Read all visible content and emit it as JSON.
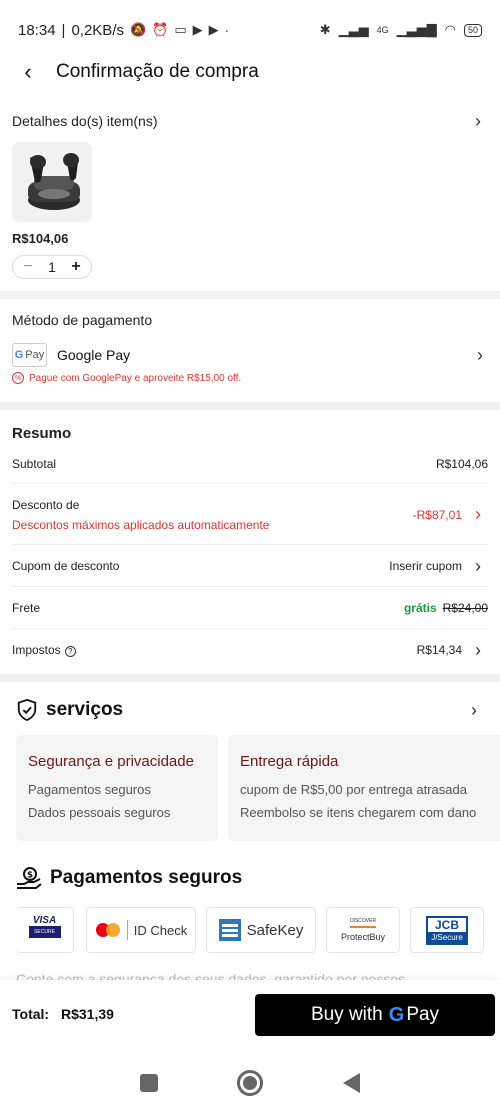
{
  "status_bar": {
    "time": "18:34",
    "speed": "0,2KB/s",
    "dot": "·",
    "network_4g": "4G",
    "battery": "50"
  },
  "header": {
    "title": "Confirmação de compra"
  },
  "items": {
    "section_title": "Detalhes do(s) item(ns)",
    "price": "R$104,06",
    "quantity": "1",
    "minus": "−",
    "plus": "+"
  },
  "payment": {
    "section_title": "Método de pagamento",
    "method_name": "Google Pay",
    "badge_pay": "Pay",
    "promo_text": "Pague com GooglePay e aproveite R$15,00 off."
  },
  "summary": {
    "title": "Resumo",
    "subtotal_label": "Subtotal",
    "subtotal_value": "R$104,06",
    "discount_label": "Desconto de",
    "discount_note": "Descontos máximos aplicados automaticamente",
    "discount_value": "-R$87,01",
    "coupon_label": "Cupom de desconto",
    "coupon_action": "Inserir cupom",
    "shipping_label": "Frete",
    "shipping_free": "grátis",
    "shipping_original": "R$24,00",
    "taxes_label": "Impostos",
    "taxes_value": "R$14,34"
  },
  "services": {
    "title": "serviços",
    "cards": [
      {
        "title": "Segurança e privacidade",
        "lines": [
          "Pagamentos seguros",
          "Dados pessoais seguros"
        ]
      },
      {
        "title": "Entrega rápida",
        "lines": [
          "cupom de R$5,00 por entrega atrasada",
          "Reembolso se itens chegarem com dano"
        ]
      }
    ]
  },
  "secure_payments": {
    "title": "Pagamentos seguros",
    "brands": {
      "visa": "VISA",
      "visa_sub": "SECURE",
      "mc": "ID Check",
      "amex": "SafeKey",
      "discover_top": "DISCOVER",
      "discover_bottom": "ProtectBuy",
      "jcb": "JCB",
      "jcb_sub": "J/Secure"
    },
    "partial_text": "Conte com a segurança dos seus dados, garantido por nossos"
  },
  "footer": {
    "total_label": "Total:",
    "total_value": "R$31,39",
    "buy_label": "Buy with",
    "buy_pay": "Pay"
  },
  "colors": {
    "accent_red": "#e0342c",
    "free_green": "#1d9a3f",
    "service_title": "#6b1818"
  }
}
